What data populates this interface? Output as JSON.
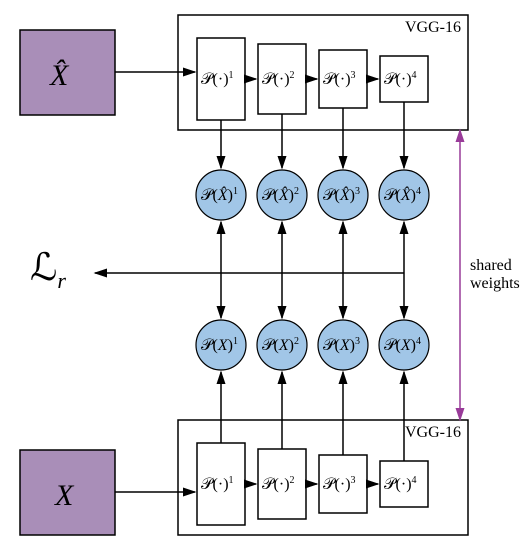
{
  "inputs": {
    "top_label": "X̂",
    "bottom_label": "X"
  },
  "vgg": {
    "title": "VGG-16",
    "blocks": [
      "𝒫(·)¹",
      "𝒫(·)²",
      "𝒫(·)³",
      "𝒫(·)⁴"
    ]
  },
  "features_top": [
    "𝒫(X̂)¹",
    "𝒫(X̂)²",
    "𝒫(X̂)³",
    "𝒫(X̂)⁴"
  ],
  "features_bottom": [
    "𝒫(X)¹",
    "𝒫(X)²",
    "𝒫(X)³",
    "𝒫(X)⁴"
  ],
  "loss": {
    "label": "ℒ",
    "subscript": "r"
  },
  "shared": {
    "line1": "shared",
    "line2": "weights"
  }
}
